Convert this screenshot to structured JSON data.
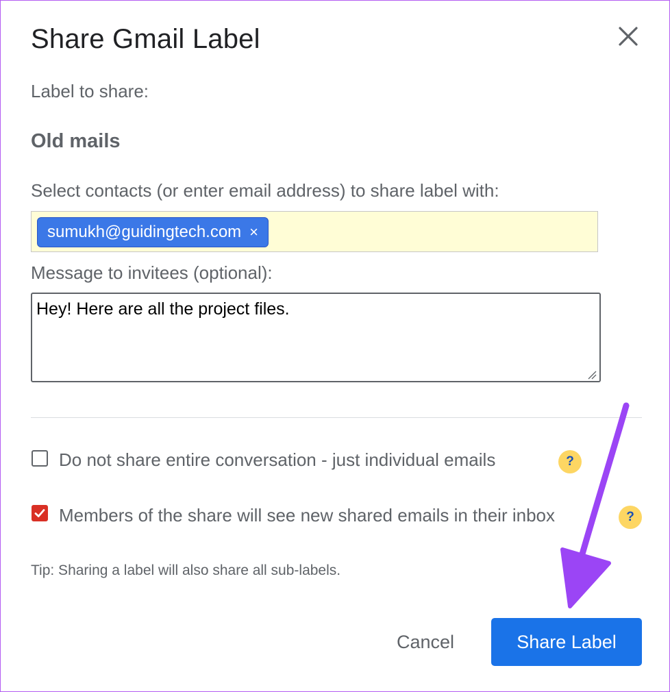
{
  "dialog": {
    "title": "Share Gmail Label",
    "close_icon": "close-icon"
  },
  "label_section": {
    "heading": "Label to share:",
    "label_name": "Old mails"
  },
  "contacts": {
    "label": "Select contacts (or enter email address) to share label with:",
    "chips": [
      {
        "email": "sumukh@guidingtech.com",
        "remove_glyph": "×"
      }
    ],
    "field_bg": "#fffdd6",
    "chip_color": "#3b78e7"
  },
  "message": {
    "label": "Message to invitees (optional):",
    "value": "Hey! Here are all the project files."
  },
  "options": [
    {
      "label": "Do not share entire conversation - just individual emails",
      "checked": false,
      "help_glyph": "?"
    },
    {
      "label": "Members of the share will see new shared emails in their inbox",
      "checked": true,
      "help_glyph": "?"
    }
  ],
  "tip": "Tip: Sharing a label will also share all sub-labels.",
  "actions": {
    "cancel_label": "Cancel",
    "share_label": "Share Label",
    "primary_color": "#1a73e8"
  },
  "annotation": {
    "arrow_color": "#9b45f5"
  }
}
